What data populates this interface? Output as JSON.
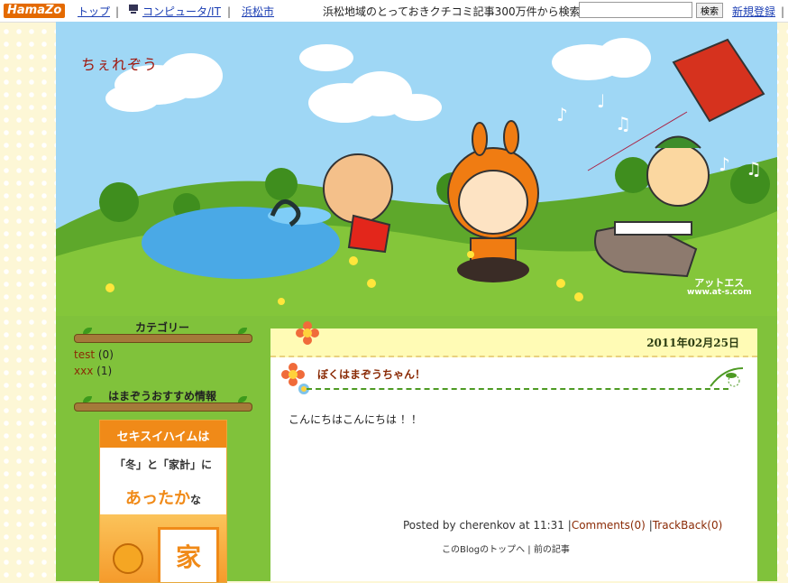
{
  "topbar": {
    "logo": "HamaZo",
    "top_link": "トップ",
    "category_link": "コンピュータ/IT",
    "sep": "|",
    "city_link": "浜松市",
    "search_label": "浜松地域のとっておきクチコミ記事300万件から検索⇒",
    "search_value": "",
    "search_button": "検索",
    "register_link": "新規登録",
    "trailing_sep": "|"
  },
  "header": {
    "blog_title": "ちぇれぞう",
    "watermark_line1": "アットエス",
    "watermark_line2": "www.at-s.com"
  },
  "sidebar": {
    "categories_title": "カテゴリー",
    "categories": [
      {
        "name": "test",
        "count": "(0)"
      },
      {
        "name": "xxx",
        "count": "(1)"
      }
    ],
    "recommend_title": "はまぞうおすすめ情報",
    "banner": {
      "title": "セキスイハイムは",
      "line2": "「冬」と「家計」に",
      "line3": "あったか",
      "line3_suffix": "な",
      "house_char": "家"
    }
  },
  "post": {
    "date": "2011年02月25日",
    "title": "ぼくはまぞうちゃん！",
    "body": "こんにちはこんにちは ！！",
    "posted_by": "Posted by cherenkov at 11:31",
    "comments": "Comments(0)",
    "trackback": "TrackBack(0)",
    "nav_top": "このBlogのトップへ",
    "nav_prev": "前の記事",
    "nav_sep": "|"
  },
  "colors": {
    "accent": "#e46a00",
    "sky": "#9fd7f5",
    "grass": "#80c23b",
    "title_red": "#a0160c",
    "link_brown": "#8a2a05"
  }
}
